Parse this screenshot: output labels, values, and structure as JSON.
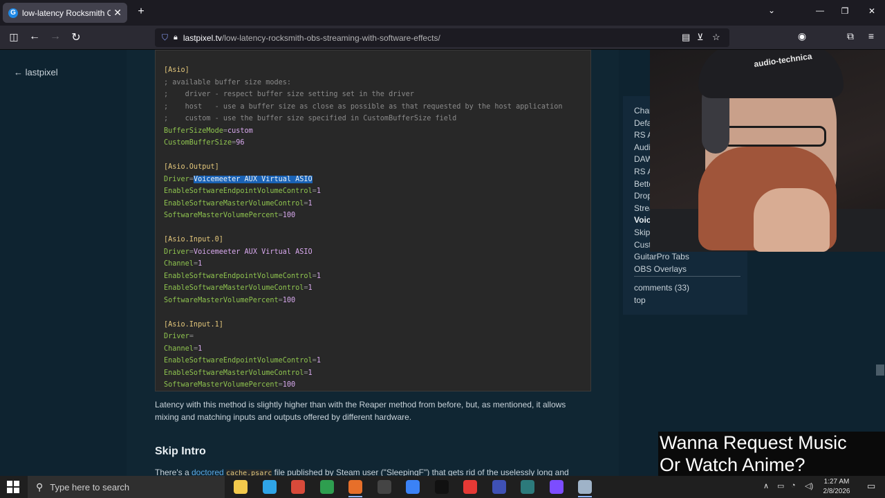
{
  "browser": {
    "tab_title": "low-latency Rocksmith OBS stre",
    "tab_close": "✕",
    "new_tab": "+",
    "url_domain": "lastpixel.tv",
    "url_path": "/low-latency-rocksmith-obs-streaming-with-software-effects/",
    "window_controls": [
      "—",
      "❐",
      "✕"
    ]
  },
  "sidebar": {
    "back_link": "← lastpixel"
  },
  "code": {
    "lines": [
      {
        "type": "sec",
        "text": "[Asio]"
      },
      {
        "type": "com",
        "text": "; available buffer size modes:"
      },
      {
        "type": "com",
        "text": ";    driver - respect buffer size setting set in the driver"
      },
      {
        "type": "com",
        "text": ";    host   - use a buffer size as close as possible as that requested by the host application"
      },
      {
        "type": "com",
        "text": ";    custom - use the buffer size specified in CustomBufferSize field"
      },
      {
        "type": "kv",
        "key": "BufferSizeMode",
        "val": "custom"
      },
      {
        "type": "kv",
        "key": "CustomBufferSize",
        "val": "96"
      },
      {
        "type": "blank"
      },
      {
        "type": "sec",
        "text": "[Asio.Output]"
      },
      {
        "type": "kvh",
        "key": "Driver",
        "val": "Voicemeeter AUX Virtual ASIO"
      },
      {
        "type": "kv",
        "key": "EnableSoftwareEndpointVolumeControl",
        "val": "1"
      },
      {
        "type": "kv",
        "key": "EnableSoftwareMasterVolumeControl",
        "val": "1"
      },
      {
        "type": "kv",
        "key": "SoftwareMasterVolumePercent",
        "val": "100"
      },
      {
        "type": "blank"
      },
      {
        "type": "sec",
        "text": "[Asio.Input.0]"
      },
      {
        "type": "kv",
        "key": "Driver",
        "val": "Voicemeeter AUX Virtual ASIO"
      },
      {
        "type": "kv",
        "key": "Channel",
        "val": "1"
      },
      {
        "type": "kv",
        "key": "EnableSoftwareEndpointVolumeControl",
        "val": "1"
      },
      {
        "type": "kv",
        "key": "EnableSoftwareMasterVolumeControl",
        "val": "1"
      },
      {
        "type": "kv",
        "key": "SoftwareMasterVolumePercent",
        "val": "100"
      },
      {
        "type": "blank"
      },
      {
        "type": "sec",
        "text": "[Asio.Input.1]"
      },
      {
        "type": "kv",
        "key": "Driver",
        "val": ""
      },
      {
        "type": "kv",
        "key": "Channel",
        "val": "1"
      },
      {
        "type": "kv",
        "key": "EnableSoftwareEndpointVolumeControl",
        "val": "1"
      },
      {
        "type": "kv",
        "key": "EnableSoftwareMasterVolumeControl",
        "val": "1"
      },
      {
        "type": "kv",
        "key": "SoftwareMasterVolumePercent",
        "val": "100"
      }
    ]
  },
  "article": {
    "paragraph": "Latency with this method is slightly higher than with the Reaper method from before, but, as mentioned, it allows mixing and matching inputs and outputs offered by different hardware.",
    "heading": "Skip Intro",
    "para2_pre": "There's a ",
    "para2_link": "doctored",
    "para2_code": "cache.psarc",
    "para2_post": " file published by Steam user (\"SleepingF\") that gets rid of the uselessly long and"
  },
  "toc": {
    "items": [
      "Changelog",
      "Default Rocksmith",
      "RS ASIO",
      "Audio Interfaces",
      "DAW - Reaper",
      "RS ASIO w/ Re",
      "Better Not",
      "Drop Pe",
      "Stream",
      "Voice",
      "Skip",
      "Cust",
      "GuitarPro Tabs",
      "OBS Overlays"
    ],
    "active_index": 9,
    "comments": "comments (33)",
    "top": "top"
  },
  "webcam": {
    "hat_text": "audio-technica"
  },
  "overlay": {
    "line1": "Wanna Request Music",
    "line2": "Or Watch Anime?"
  },
  "taskbar": {
    "search_placeholder": "Type here to search",
    "time": "1:27 AM",
    "date": "2/8/2026",
    "icon_colors": [
      "#f2c94c",
      "#2fa4e7",
      "#d84a3a",
      "#2e9e4f",
      "#e76f2a",
      "#444444",
      "#3b82f6",
      "#111111",
      "#e53935",
      "#3f51b5",
      "#2c7a7b",
      "#7c4dff",
      "#9fb3c8"
    ]
  },
  "colors": {
    "page_bg": "#0e2330",
    "code_bg": "#282828",
    "selection": "#1a62b5",
    "link": "#5aa9e6"
  }
}
